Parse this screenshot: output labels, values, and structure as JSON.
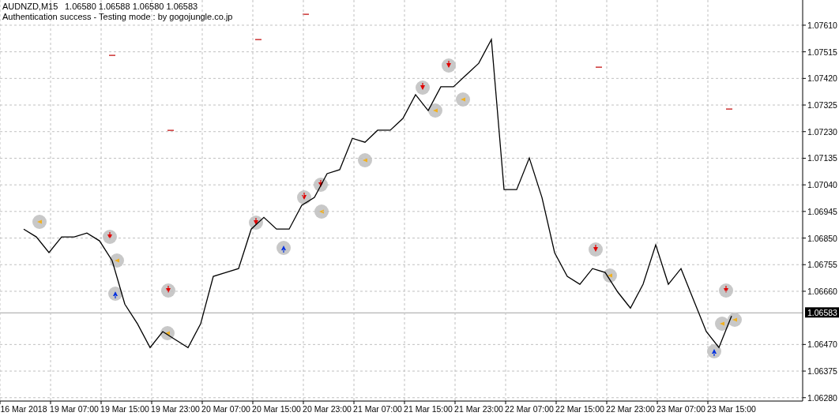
{
  "header": {
    "symbol": "AUDNZD,M15",
    "ohlc": "1.06580 1.06588 1.06580 1.06583",
    "message": "Authentication success - Testing mode : by gogojungle.co.jp"
  },
  "chart": {
    "current_price_tag": "1.06583",
    "chart_data": {
      "type": "line",
      "ylim": [
        1.06268,
        1.077
      ],
      "grid": true,
      "categories": [
        "16 Mar 2018",
        null,
        null,
        null,
        "19 Mar 07:00",
        null,
        null,
        null,
        "19 Mar 15:00",
        null,
        null,
        null,
        "19 Mar 23:00",
        null,
        null,
        null,
        "20 Mar 07:00",
        null,
        null,
        null,
        "20 Mar 15:00",
        null,
        null,
        null,
        "20 Mar 23:00",
        null,
        null,
        null,
        "21 Mar 07:00",
        null,
        null,
        null,
        "21 Mar 15:00",
        null,
        null,
        null,
        "21 Mar 23:00",
        null,
        null,
        null,
        "22 Mar 07:00",
        null,
        null,
        null,
        "22 Mar 15:00",
        null,
        null,
        null,
        "22 Mar 23:00",
        null,
        null,
        null,
        "23 Mar 07:00",
        null,
        null,
        null,
        "23 Mar 15:00",
        null,
        null,
        null,
        null,
        null
      ],
      "series": [
        {
          "color": "#000000",
          "values": [
            1.06882,
            1.06854,
            1.06798,
            1.06854,
            1.06854,
            1.06868,
            1.0684,
            1.06769,
            1.06614,
            1.06544,
            1.06459,
            1.06516,
            1.06487,
            1.06459,
            1.06544,
            1.06713,
            1.06727,
            1.06741,
            1.06882,
            1.06924,
            1.06882,
            1.06882,
            1.06967,
            1.06995,
            1.0708,
            1.07094,
            1.07206,
            1.07192,
            1.07235,
            1.07235,
            1.07277,
            1.07362,
            1.07305,
            1.0739,
            1.0739,
            1.07432,
            1.07474,
            1.07559,
            1.07023,
            1.07023,
            1.07136,
            1.06995,
            1.06798,
            1.06713,
            1.06685,
            1.06741,
            1.06727,
            1.06657,
            1.066,
            1.06685,
            1.06826,
            1.06685,
            1.06741,
            1.06628,
            1.06516,
            1.06459,
            1.06572,
            null,
            null,
            null,
            null,
            null
          ]
        }
      ],
      "yticks": [
        {
          "value": 1.0761,
          "label": "1.07610"
        },
        {
          "value": 1.07515,
          "label": "1.07515"
        },
        {
          "value": 1.0742,
          "label": "1.07420"
        },
        {
          "value": 1.07325,
          "label": "1.07325"
        },
        {
          "value": 1.0723,
          "label": "1.07230"
        },
        {
          "value": 1.07135,
          "label": "1.07135"
        },
        {
          "value": 1.0704,
          "label": "1.07040"
        },
        {
          "value": 1.06945,
          "label": "1.06945"
        },
        {
          "value": 1.0685,
          "label": "1.06850"
        },
        {
          "value": 1.06755,
          "label": "1.06755"
        },
        {
          "value": 1.0666,
          "label": "1.06660"
        },
        {
          "value": 1.0647,
          "label": "1.06470"
        },
        {
          "value": 1.06375,
          "label": "1.06375"
        },
        {
          "value": 1.0628,
          "label": "1.06280"
        }
      ]
    }
  }
}
